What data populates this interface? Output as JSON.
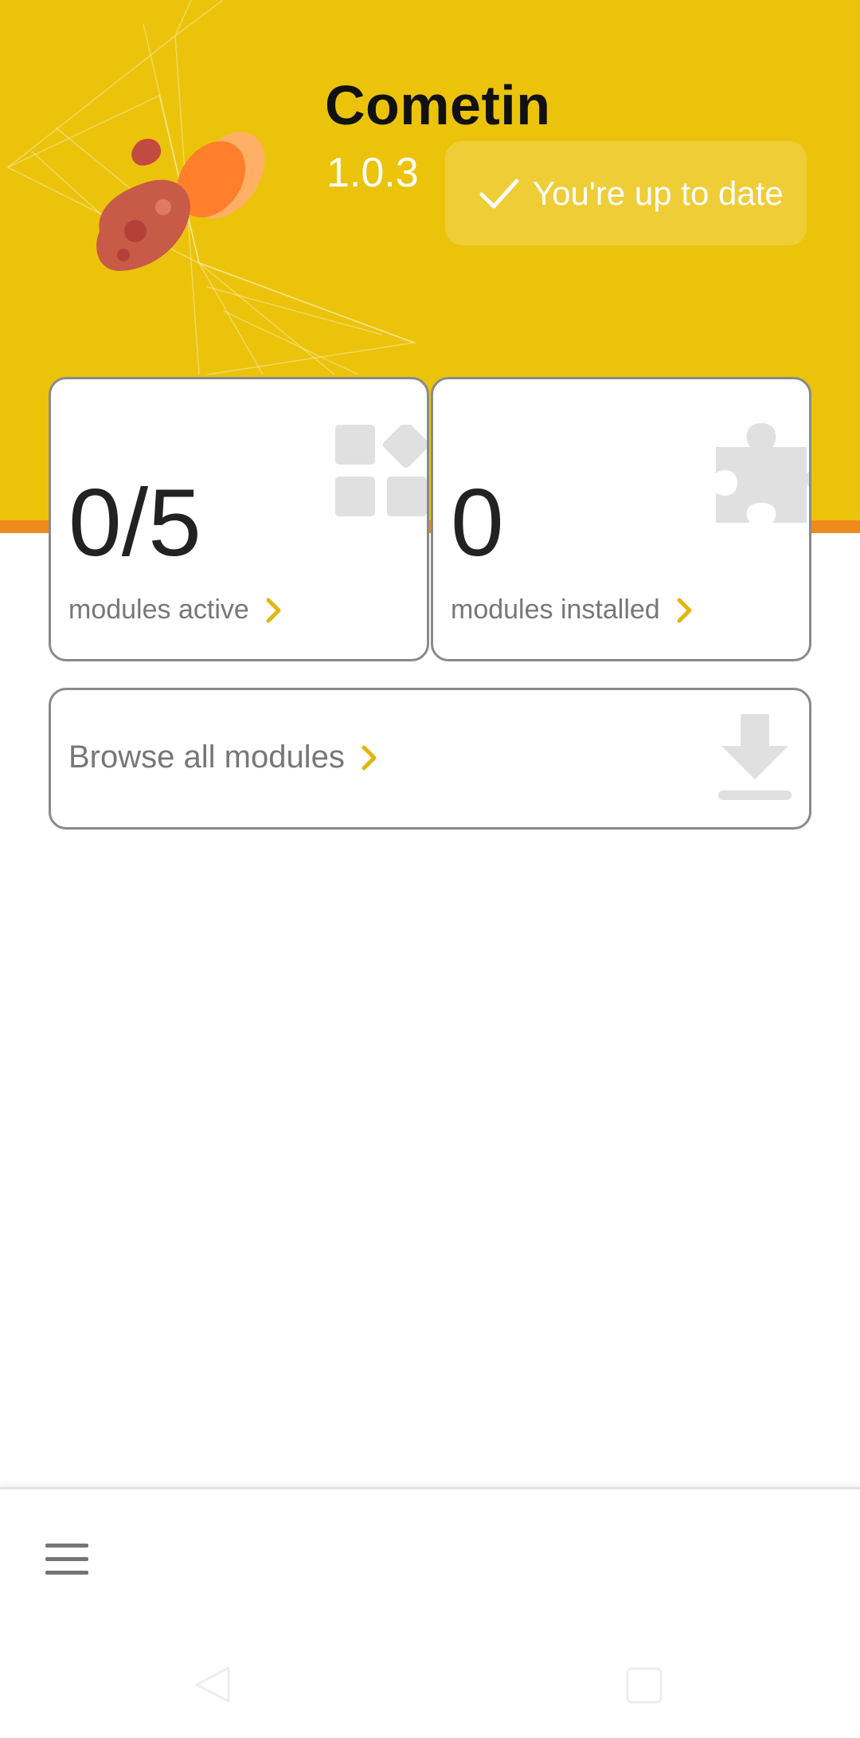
{
  "header": {
    "app_title": "Cometin",
    "version": "1.0.3",
    "status_text": "You're up to date",
    "status_icon": "check-icon",
    "logo_icon": "comet-icon"
  },
  "cards": {
    "active": {
      "value": "0/5",
      "label": "modules active",
      "icon": "modules-grid-icon"
    },
    "installed": {
      "value": "0",
      "label": "modules installed",
      "icon": "puzzle-icon"
    },
    "browse": {
      "label": "Browse all modules",
      "icon": "download-icon"
    }
  },
  "bottom_bar": {
    "menu_icon": "hamburger-menu-icon"
  },
  "colors": {
    "header_bg": "#EBC30B",
    "accent_stripe": "#F08A1C",
    "chevron": "#E2B60F"
  }
}
